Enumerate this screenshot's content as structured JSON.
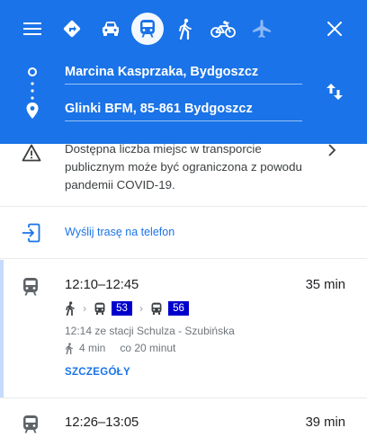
{
  "header": {
    "menu_icon": "menu-icon",
    "modes": [
      {
        "name": "best-route",
        "icon": "diamond-turn-icon",
        "selected": false
      },
      {
        "name": "driving",
        "icon": "car-icon",
        "selected": false
      },
      {
        "name": "transit",
        "icon": "train-icon",
        "selected": true
      },
      {
        "name": "walking",
        "icon": "walk-icon",
        "selected": false
      },
      {
        "name": "cycling",
        "icon": "bike-icon",
        "selected": false
      },
      {
        "name": "flights",
        "icon": "plane-icon",
        "selected": false
      }
    ],
    "close_icon": "close-icon",
    "accent": "#1a73e8"
  },
  "route": {
    "origin": "Marcina Kasprzaka, Bydgoszcz",
    "destination": "Glinki BFM, 85-861 Bydgoszcz"
  },
  "notice": {
    "text": "Dostępna liczba miejsc w transporcie publicznym może być ograniczona z powodu pandemii COVID-19."
  },
  "send_to_phone": {
    "label": "Wyślij trasę na telefon"
  },
  "routes": [
    {
      "time_range": "12:10–12:45",
      "duration": "35 min",
      "lines": [
        "53",
        "56"
      ],
      "departure_info": "12:14 ze stacji Schulza - Szubińska",
      "walk_time": "4 min",
      "frequency": "co 20 minut",
      "details_label": "SZCZEGÓŁY"
    },
    {
      "time_range": "12:26–13:05",
      "duration": "39 min"
    }
  ],
  "colors": {
    "line_badge": "#0000cc",
    "link": "#1a73e8"
  }
}
